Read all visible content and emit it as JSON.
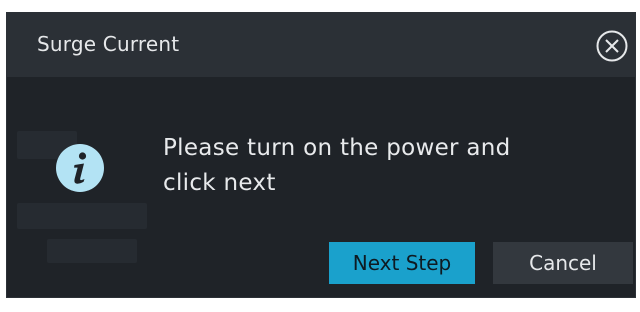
{
  "dialog": {
    "title": "Surge Current",
    "close_icon": "close-circle-icon",
    "info_icon": "info-icon",
    "message_line1": "Please turn on the power and",
    "message_line2": "click next"
  },
  "buttons": {
    "next_label": "Next Step",
    "cancel_label": "Cancel"
  },
  "colors": {
    "dialog_bg": "#1f2328",
    "header_bg": "#2b3036",
    "accent": "#1aa1cc",
    "info_icon_fill": "#b3e3f4",
    "cancel_bg": "#33383e",
    "text": "#e6e8ea"
  }
}
